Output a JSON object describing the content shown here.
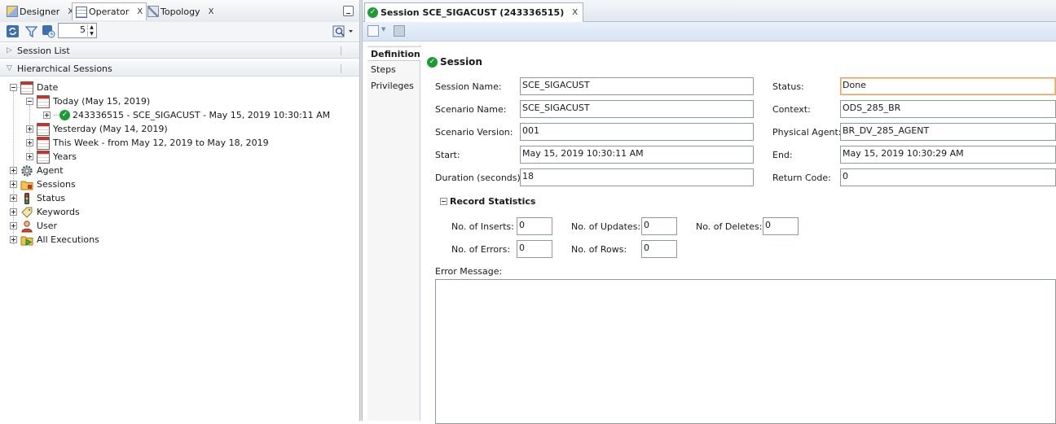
{
  "left": {
    "tabs": [
      {
        "label": "Designer",
        "close": "X"
      },
      {
        "label": "Operator",
        "close": "X"
      },
      {
        "label": "Topology",
        "close": "X"
      }
    ],
    "refresh_count": "5",
    "accordion": {
      "session_list": "Session List",
      "hierarchical_sessions": "Hierarchical Sessions"
    },
    "tree": {
      "date": "Date",
      "today": "Today (May 15, 2019)",
      "session_item": "243336515 - SCE_SIGACUST - May 15, 2019 10:30:11 AM",
      "yesterday": "Yesterday (May 14, 2019)",
      "this_week": "This Week - from May 12, 2019 to May 18, 2019",
      "years": "Years",
      "agent": "Agent",
      "sessions": "Sessions",
      "status": "Status",
      "keywords": "Keywords",
      "user": "User",
      "all_executions": "All Executions"
    }
  },
  "right": {
    "tab": {
      "label": "Session SCE_SIGACUST (243336515)",
      "close": "X"
    },
    "side_tabs": {
      "definition": "Definition",
      "steps": "Steps",
      "privileges": "Privileges"
    },
    "section_title": "Session",
    "fields": {
      "session_name": {
        "label": "Session Name:",
        "value": "SCE_SIGACUST"
      },
      "scenario_name": {
        "label": "Scenario Name:",
        "value": "SCE_SIGACUST"
      },
      "scenario_version": {
        "label": "Scenario Version:",
        "value": "001"
      },
      "start": {
        "label": "Start:",
        "value": "May 15, 2019 10:30:11 AM"
      },
      "duration": {
        "label": "Duration (seconds):",
        "value": "18"
      },
      "status": {
        "label": "Status:",
        "value": "Done"
      },
      "context": {
        "label": "Context:",
        "value": "ODS_285_BR"
      },
      "physical_agent": {
        "label": "Physical Agent:",
        "value": "BR_DV_285_AGENT"
      },
      "end": {
        "label": "End:",
        "value": "May 15, 2019 10:30:29 AM"
      },
      "return_code": {
        "label": "Return Code:",
        "value": "0"
      }
    },
    "record_statistics": {
      "title": "Record Statistics",
      "inserts": {
        "label": "No. of Inserts:",
        "value": "0"
      },
      "updates": {
        "label": "No. of Updates:",
        "value": "0"
      },
      "deletes": {
        "label": "No. of Deletes:",
        "value": "0"
      },
      "errors": {
        "label": "No. of Errors:",
        "value": "0"
      },
      "rows": {
        "label": "No. of Rows:",
        "value": "0"
      }
    },
    "error_message_label": "Error Message:",
    "error_message_value": ""
  },
  "colors": {
    "success": "#1d9b34",
    "focus_border": "#e8a25a",
    "toolbar_blue": "#d7e4f3"
  }
}
